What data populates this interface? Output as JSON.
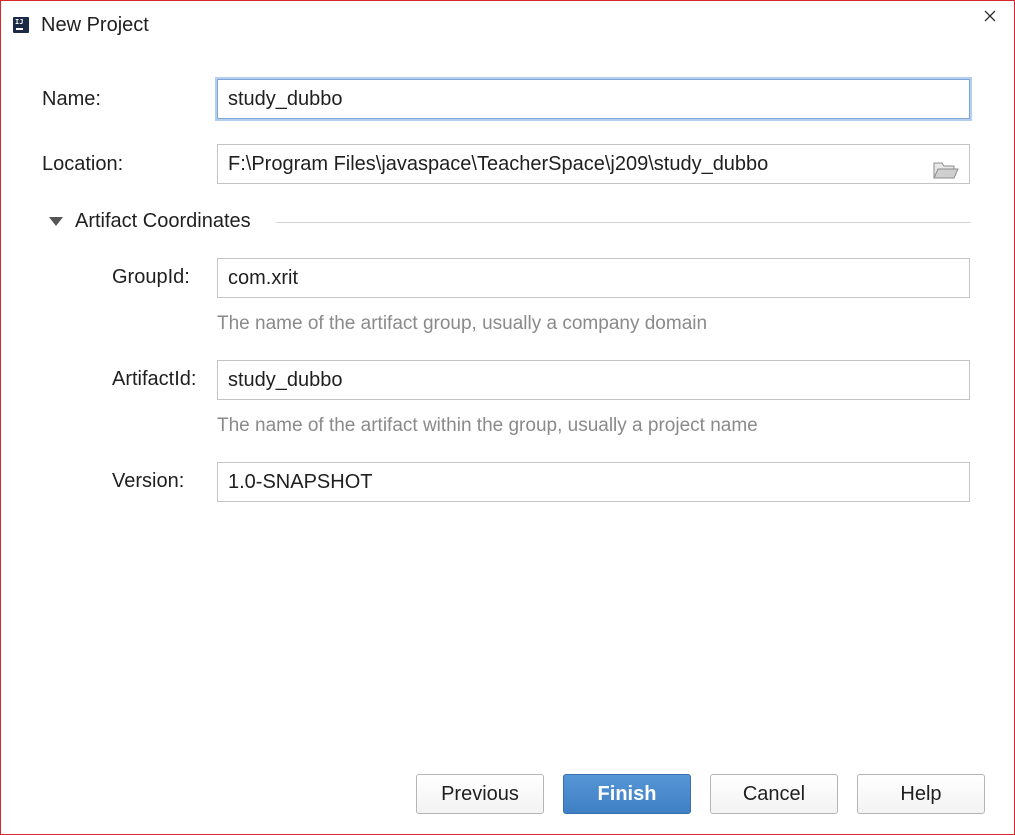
{
  "window": {
    "title": "New Project",
    "app_icon": "intellij-idea-icon",
    "close_icon": "close-icon"
  },
  "form": {
    "name": {
      "label": "Name:",
      "value": "study_dubbo"
    },
    "location": {
      "label": "Location:",
      "value": "F:\\Program Files\\javaspace\\TeacherSpace\\j209\\study_dubbo",
      "browse_icon": "folder-open-icon"
    }
  },
  "artifact_coordinates": {
    "title": "Artifact Coordinates",
    "expanded": true,
    "group_id": {
      "label": "GroupId:",
      "value": "com.xrit",
      "hint": "The name of the artifact group, usually a company domain"
    },
    "artifact_id": {
      "label": "ArtifactId:",
      "value": "study_dubbo",
      "hint": "The name of the artifact within the group, usually a project name"
    },
    "version": {
      "label": "Version:",
      "value": "1.0-SNAPSHOT"
    }
  },
  "buttons": {
    "previous": "Previous",
    "finish": "Finish",
    "cancel": "Cancel",
    "help": "Help"
  },
  "colors": {
    "window_border": "#d9272e",
    "primary_button": "#4a8ad0",
    "focus_ring": "#b5cff0",
    "hint_text": "#8a8a8a"
  }
}
